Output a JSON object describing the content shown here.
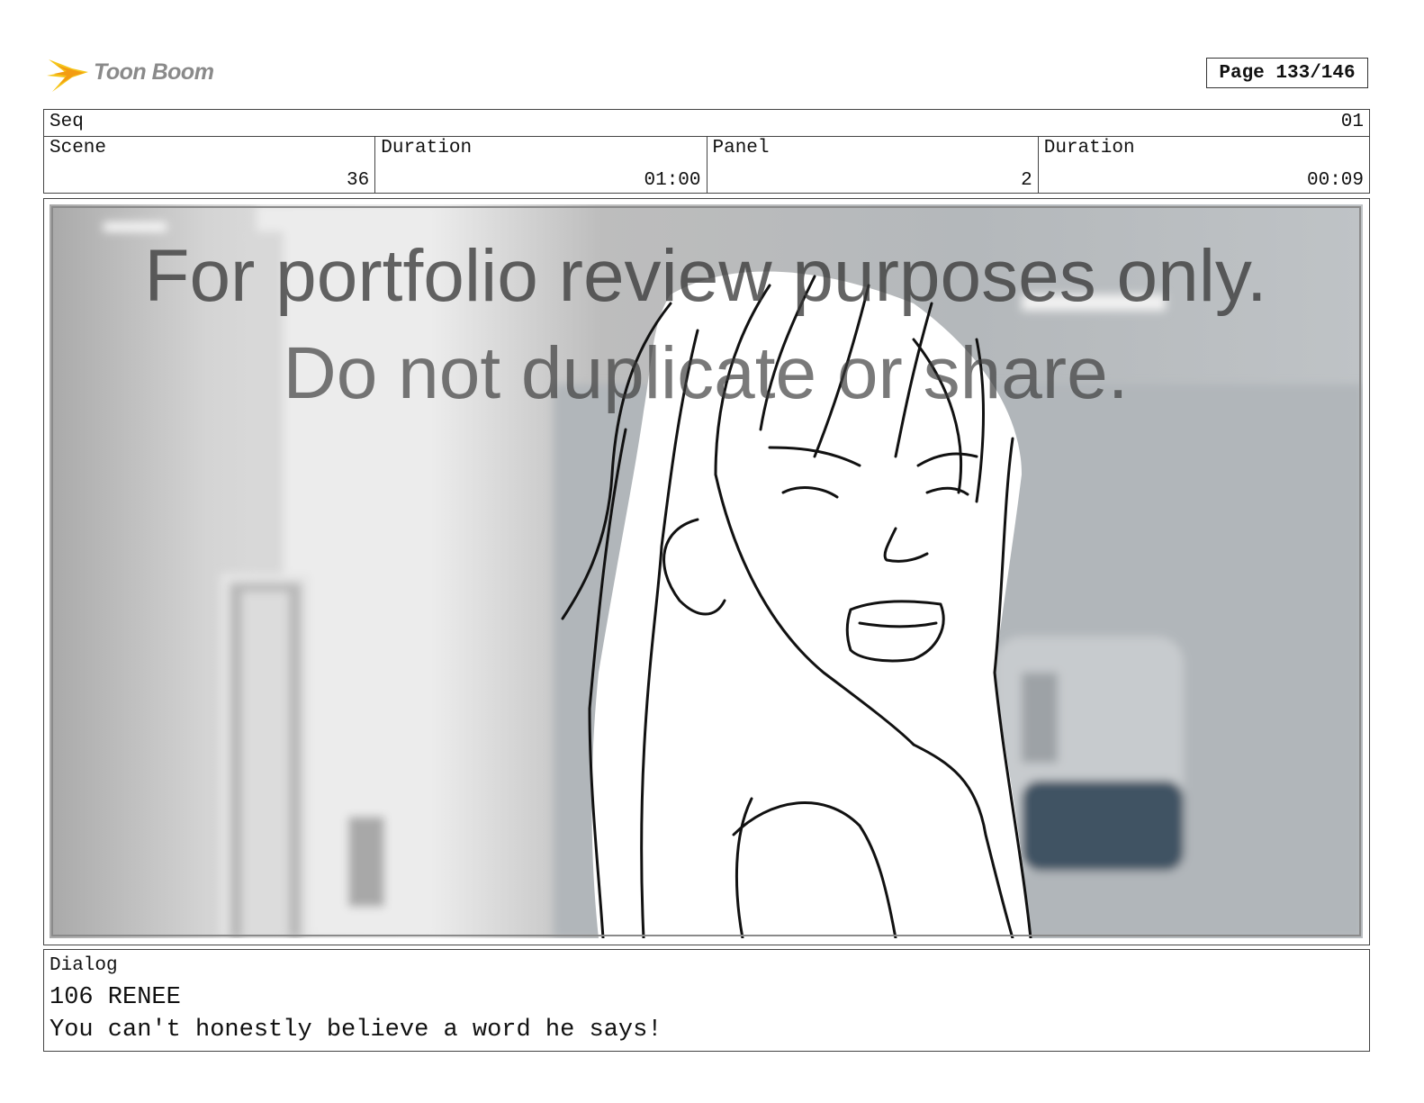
{
  "header": {
    "logo_text": "Toon Boom",
    "page_label": "Page 133/146"
  },
  "sequence": {
    "label": "Seq",
    "value": "01"
  },
  "info": {
    "scene_label": "Scene",
    "scene_value": "36",
    "scene_duration_label": "Duration",
    "scene_duration_value": "01:00",
    "panel_label": "Panel",
    "panel_value": "2",
    "panel_duration_label": "Duration",
    "panel_duration_value": "00:09"
  },
  "panel": {
    "watermark_line1": "For portfolio review purposes only.",
    "watermark_line2": "Do not duplicate or share."
  },
  "dialog": {
    "label": "Dialog",
    "line1": "106 RENEE",
    "line2": "You can't honestly believe a word he says!"
  }
}
